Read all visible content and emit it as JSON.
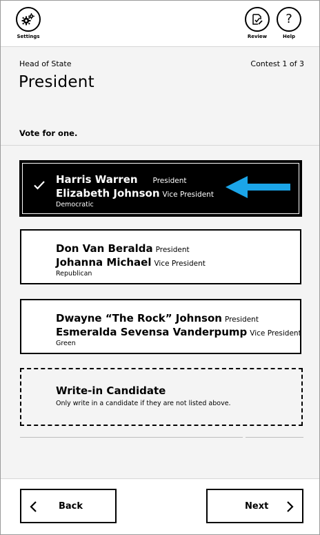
{
  "topbar": {
    "settings_label": "Settings",
    "review_label": "Review",
    "help_label": "Help",
    "help_glyph": "?"
  },
  "contest": {
    "office_subtitle": "Head of State",
    "counter": "Contest 1 of 3",
    "title": "President",
    "instructions": "Vote for one."
  },
  "candidates": [
    {
      "president": "Harris Warren",
      "president_role": "President",
      "vice": "Elizabeth Johnson",
      "vice_role": "Vice President",
      "party": "Democratic",
      "selected": true
    },
    {
      "president": "Don Van Beralda",
      "president_role": "President",
      "vice": "Johanna Michael",
      "vice_role": "Vice President",
      "party": "Republican",
      "selected": false
    },
    {
      "president": "Dwayne “The Rock” Johnson",
      "president_role": "President",
      "vice": "Esmeralda Sevensa Vanderpump",
      "vice_role": "Vice President",
      "party": "Green",
      "selected": false
    }
  ],
  "writein": {
    "title": "Write-in Candidate",
    "note": "Only write in a candidate if they are not listed above."
  },
  "footer": {
    "back_label": "Back",
    "next_label": "Next"
  },
  "colors": {
    "arrow": "#1ba5e8",
    "selected_bg": "#000000",
    "page_bg": "#f4f4f4"
  },
  "icons": [
    "gears-icon",
    "review-icon",
    "help-icon",
    "checkmark-icon",
    "arrow-left-icon",
    "chevron-left-icon",
    "chevron-right-icon"
  ]
}
